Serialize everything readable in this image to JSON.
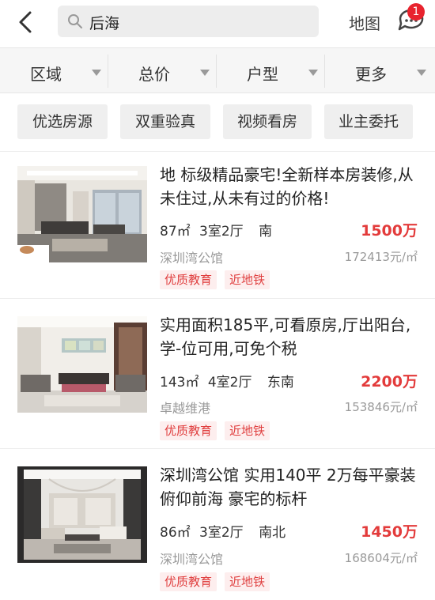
{
  "header": {
    "search_text": "后海",
    "map_label": "地图",
    "message_badge": "1"
  },
  "filters": [
    {
      "label": "区域"
    },
    {
      "label": "总价"
    },
    {
      "label": "户型"
    },
    {
      "label": "更多"
    }
  ],
  "quick_tags": [
    {
      "label": "优选房源"
    },
    {
      "label": "双重验真"
    },
    {
      "label": "视频看房"
    },
    {
      "label": "业主委托"
    }
  ],
  "listings": [
    {
      "title": "地 标级精品豪宅!全新样本房装修,从未住过,从未有过的价格!",
      "area": "87㎡",
      "layout": "3室2厅",
      "orientation": "南",
      "price": "1500万",
      "estate": "深圳湾公馆",
      "unit_price": "172413元/㎡",
      "tags": [
        "优质教育",
        "近地铁"
      ]
    },
    {
      "title": "实用面积185平,可看原房,厅出阳台,学-位可用,可免个税",
      "area": "143㎡",
      "layout": "4室2厅",
      "orientation": "东南",
      "price": "2200万",
      "estate": "卓越维港",
      "unit_price": "153846元/㎡",
      "tags": [
        "优质教育",
        "近地铁"
      ]
    },
    {
      "title": "深圳湾公馆 实用140平 2万每平豪装俯仰前海 豪宅的标杆",
      "area": "86㎡",
      "layout": "3室2厅",
      "orientation": "南北",
      "price": "1450万",
      "estate": "深圳湾公馆",
      "unit_price": "168604元/㎡",
      "tags": [
        "优质教育",
        "近地铁"
      ]
    }
  ],
  "colors": {
    "accent_red": "#e33b3b",
    "badge_red": "#e8232e",
    "tag_bg": "#fdeeee"
  }
}
